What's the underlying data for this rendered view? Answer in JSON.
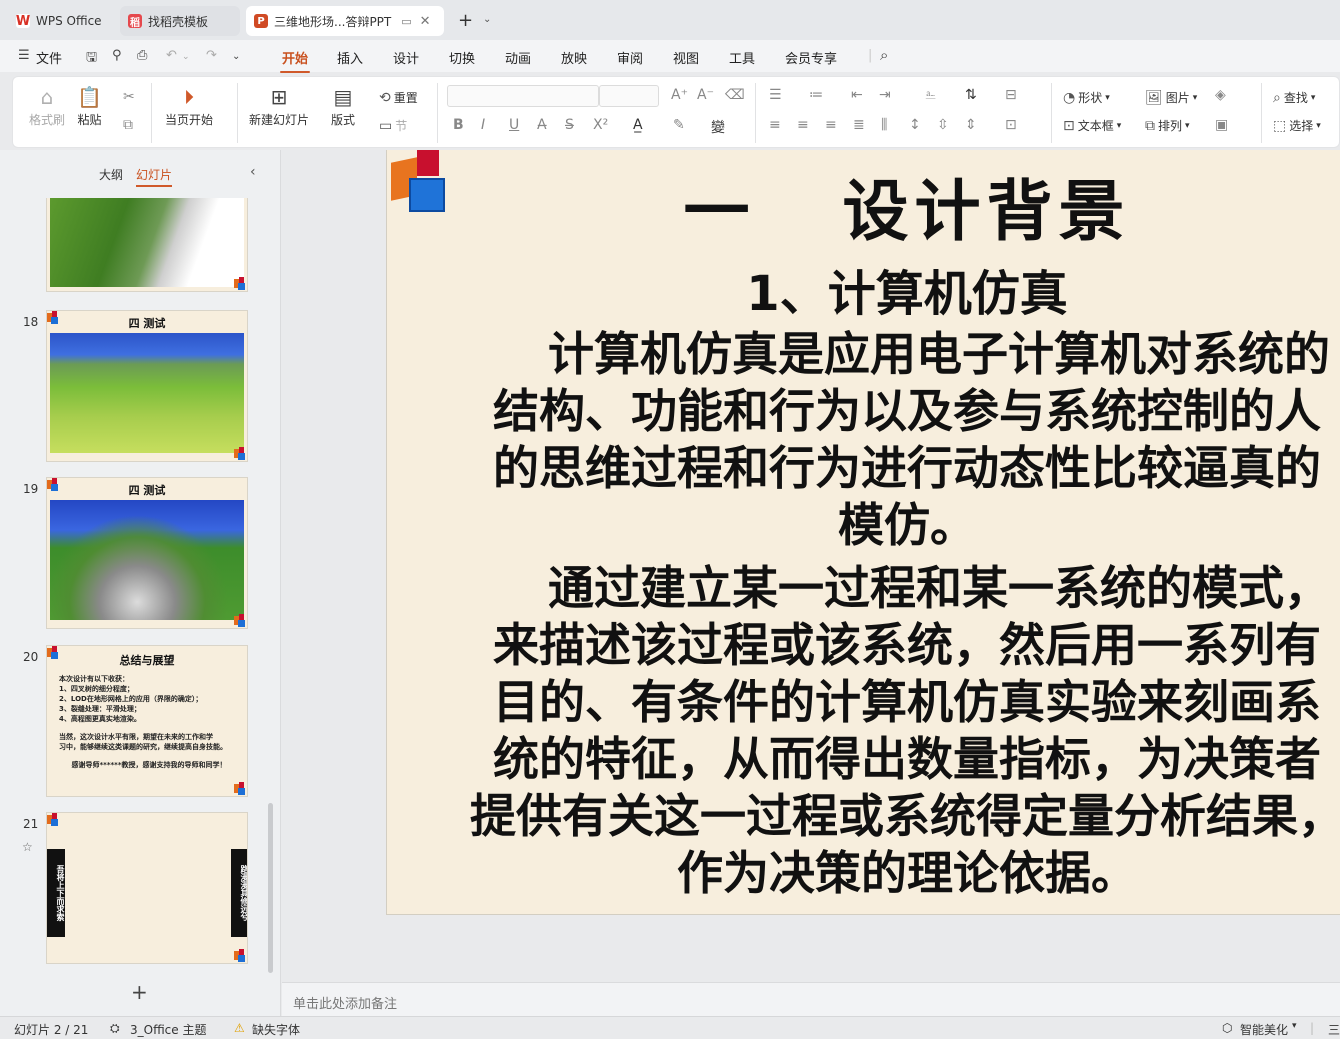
{
  "tabs": [
    {
      "label": "WPS Office",
      "icon": "wps-logo-icon",
      "color": "#d93025"
    },
    {
      "label": "找稻壳模板",
      "icon": "docer-icon",
      "color": "#e5484d"
    },
    {
      "label": "三维地形场...答辩PPT",
      "icon": "ppt-icon",
      "color": "#d04a24",
      "active": true
    }
  ],
  "menu": {
    "file": "文件",
    "items": [
      "开始",
      "插入",
      "设计",
      "切换",
      "动画",
      "放映",
      "审阅",
      "视图",
      "工具",
      "会员专享"
    ],
    "active": "开始"
  },
  "ribbon": {
    "format_painter": "格式刷",
    "paste": "粘贴",
    "play_from_current": "当页开始",
    "new_slide": "新建幻灯片",
    "layout": "版式",
    "reset": "重置",
    "section": "节",
    "shape": "形状",
    "image": "图片",
    "textbox": "文本框",
    "arrange": "排列",
    "find": "查找",
    "select": "选择"
  },
  "panel": {
    "outline_tab": "大纲",
    "slides_tab": "幻灯片",
    "slides": [
      {
        "number": "",
        "title": ""
      },
      {
        "number": "18",
        "title": "四 测试"
      },
      {
        "number": "19",
        "title": "四 测试"
      },
      {
        "number": "20",
        "title": "总结与展望",
        "lines": [
          "本次设计有以下收获：",
          "1、四叉树的细分程度；",
          "2、LOD在地形网格上的应用（界限的确定）；",
          "3、裂缝处理：平滑处理；",
          "4、高程图更真实地渲染。",
          "",
          "当然，这次设计水平有限，期望在未来的工作和学",
          "习中，能够继续这类课题的研究，继续提高自身技能。",
          "",
          "感谢导师******教授，感谢支持我的导师和同学！"
        ]
      },
      {
        "number": "21",
        "title": "",
        "left_banner": "吾将上下而求索",
        "right_banner": "路漫漫其修远兮"
      }
    ]
  },
  "slide": {
    "title": "一   设计背景",
    "subtitle": "1、计算机仿真",
    "para1": "    计算机仿真是应用电子计算机对系统的\n结构、功能和行为以及参与系统控制的人\n的思维过程和行为进行动态性比较逼真的\n模仿。",
    "para2": "    通过建立某一过程和某一系统的模式，\n来描述该过程或该系统，然后用一系列有\n目的、有条件的计算机仿真实验来刻画系\n统的特征，从而得出数量指标，为决策者\n提供有关这一过程或系统得定量分析结果，\n作为决策的理论依据。"
  },
  "notes_placeholder": "单击此处添加备注",
  "status": {
    "slide_counter": "幻灯片 2 / 21",
    "theme": "3_Office 主题",
    "missing_font": "缺失字体",
    "smart_beautify": "智能美化",
    "more": "三"
  },
  "colors": {
    "accent": "#d0592a",
    "slide_bg": "#f7eedd"
  }
}
